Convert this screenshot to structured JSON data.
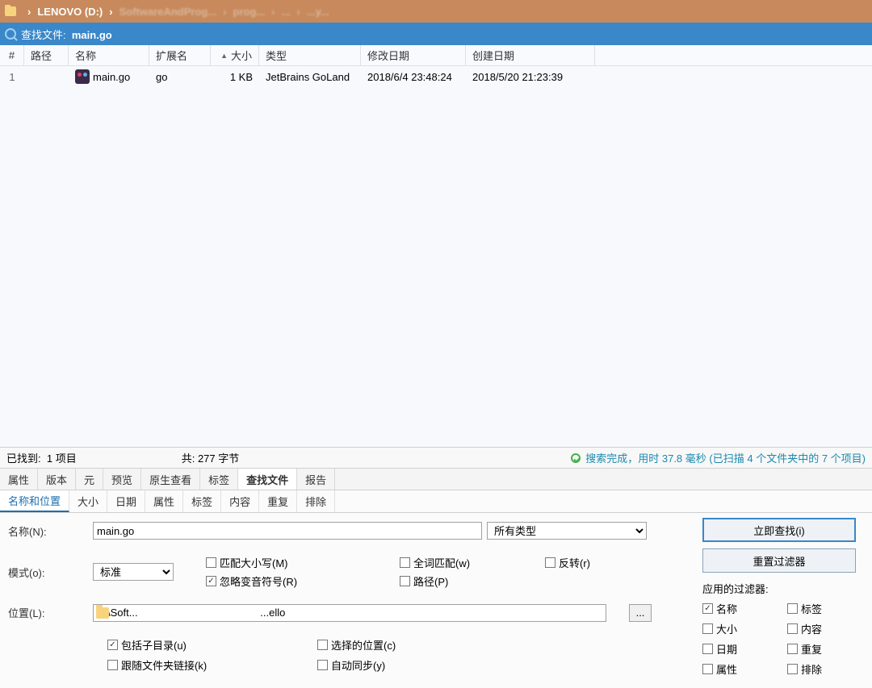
{
  "breadcrumb": {
    "drive": "LENOVO (D:)",
    "seg1": "SoftwareAndProg...",
    "seg2": "prog...",
    "seg3": "...",
    "seg4": "...y..."
  },
  "searchbar": {
    "prefix": "查找文件:",
    "query": "main.go"
  },
  "columns": {
    "num": "#",
    "path": "路径",
    "name": "名称",
    "ext": "扩展名",
    "size": "大小",
    "type": "类型",
    "mod": "修改日期",
    "create": "创建日期"
  },
  "row": {
    "num": "1",
    "name": "main.go",
    "ext": "go",
    "size": "1 KB",
    "type": "JetBrains GoLand",
    "mod": "2018/6/4 23:48:24",
    "create": "2018/5/20 21:23:39"
  },
  "status": {
    "found_label": "已找到:",
    "found_value": "1 项目",
    "total_label": "共:",
    "total_value": "277 字节",
    "done1": "搜索完成，用时 ",
    "done_ms": "37.8",
    "done2": " 毫秒 (已扫描 ",
    "done_folders": "4",
    "done3": " 个文件夹中的 ",
    "done_items": "7",
    "done4": " 个项目)"
  },
  "tabs1": {
    "t1": "属性",
    "t2": "版本",
    "t3": "元",
    "t4": "预览",
    "t5": "原生查看",
    "t6": "标签",
    "t7": "查找文件",
    "t8": "报告"
  },
  "tabs2": {
    "t1": "名称和位置",
    "t2": "大小",
    "t3": "日期",
    "t4": "属性",
    "t5": "标签",
    "t6": "内容",
    "t7": "重复",
    "t8": "排除"
  },
  "form": {
    "name_label": "名称(N):",
    "name_value": "main.go",
    "type_value": "所有类型",
    "mode_label": "模式(o):",
    "mode_value": "标准",
    "ck_case": "匹配大小写(M)",
    "ck_ignore": "忽略变音符号(R)",
    "ck_whole": "全词匹配(w)",
    "ck_path": "路径(P)",
    "ck_invert": "反转(r)",
    "loc_label": "位置(L):",
    "loc_value": "D:\\Soft...                                          ...ello",
    "ck_sub": "包括子目录(u)",
    "ck_follow": "跟随文件夹链接(k)",
    "ck_sel": "选择的位置(c)",
    "ck_sync": "自动同步(y)",
    "browse": "..."
  },
  "right": {
    "search_now": "立即查找(i)",
    "reset": "重置过滤器",
    "filters_title": "应用的过滤器:",
    "f_name": "名称",
    "f_tag": "标签",
    "f_size": "大小",
    "f_content": "内容",
    "f_date": "日期",
    "f_dup": "重复",
    "f_attr": "属性",
    "f_excl": "排除"
  }
}
